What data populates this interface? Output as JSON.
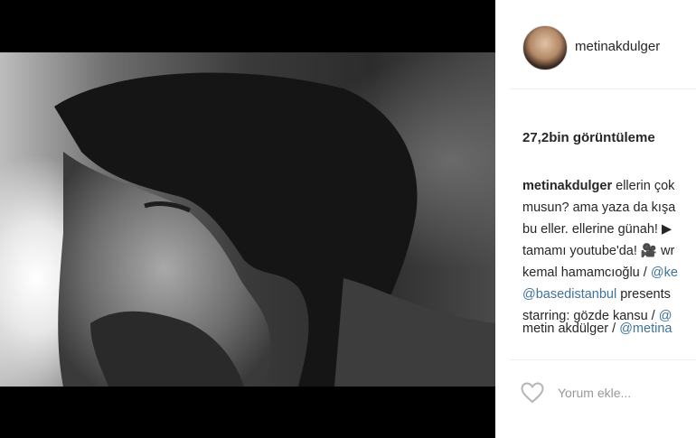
{
  "post": {
    "username": "metinakdulger",
    "views": "27,2bin görüntüleme",
    "caption": {
      "line1_text": "ellerin çok",
      "line2": "musun? ama yaza da kışa",
      "line3": "bu eller. ellerine günah! ▶",
      "line4": "tamamı youtube'da! 🎥 wr",
      "line5_text": "kemal hamamcıoğlu / ",
      "line5_mention": "@ke",
      "line6_mention": "@basedistanbul",
      "line6_text": " presents",
      "line7_text": "starring: gözde kansu / ",
      "line7_mention": "@",
      "line8_text": "metin akdülger / ",
      "line8_mention": "@metina"
    },
    "comment_placeholder": "Yorum ekle..."
  },
  "icons": {
    "like": "heart-outline-icon"
  },
  "colors": {
    "mention": "#3f729b",
    "panel_bg": "#ffffff",
    "video_bg": "#000000"
  }
}
